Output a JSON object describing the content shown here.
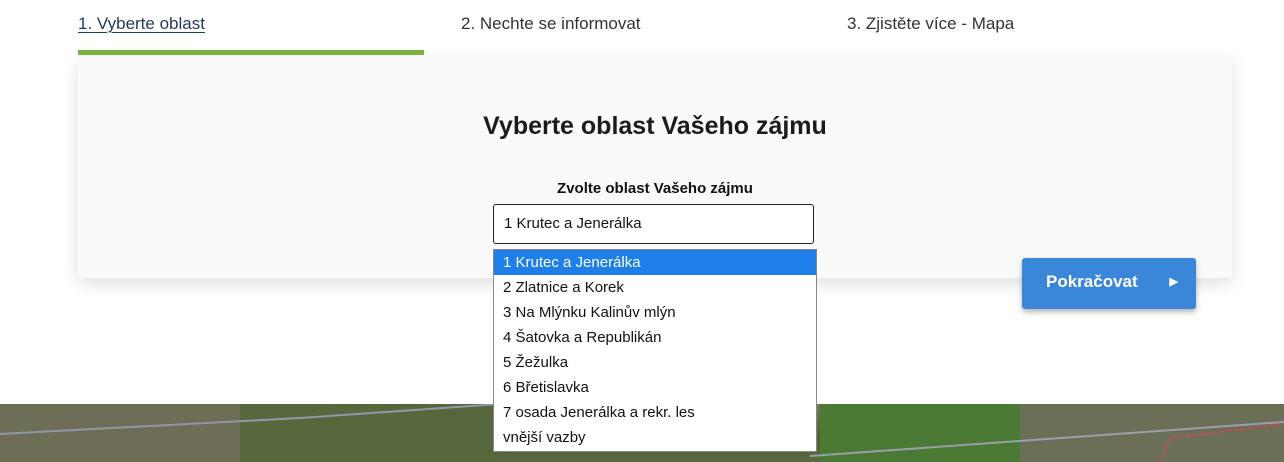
{
  "steps": [
    {
      "label": "1. Vyberte oblast",
      "active": true
    },
    {
      "label": "2. Nechte se informovat",
      "active": false
    },
    {
      "label": "3. Zjistěte více - Mapa",
      "active": false
    }
  ],
  "card": {
    "title": "Vyberte oblast Vašeho zájmu",
    "field_label": "Zvolte oblast Vašeho zájmu",
    "select_value": "1 Krutec a Jenerálka"
  },
  "dropdown": {
    "options": [
      "1 Krutec a Jenerálka",
      "2 Zlatnice a Korek",
      "3 Na Mlýnku Kalinův mlýn",
      "4 Šatovka a Republikán",
      "5 Žežulka",
      "6 Břetislavka",
      "7 osada Jenerálka a rekr. les",
      "vnější vazby"
    ],
    "selected_index": 0
  },
  "continue_button": {
    "label": "Pokračovat",
    "icon": "caret-right-icon"
  },
  "colors": {
    "accent": "#7cb342",
    "button": "#3a86d9",
    "highlight": "#1e7fe8"
  }
}
